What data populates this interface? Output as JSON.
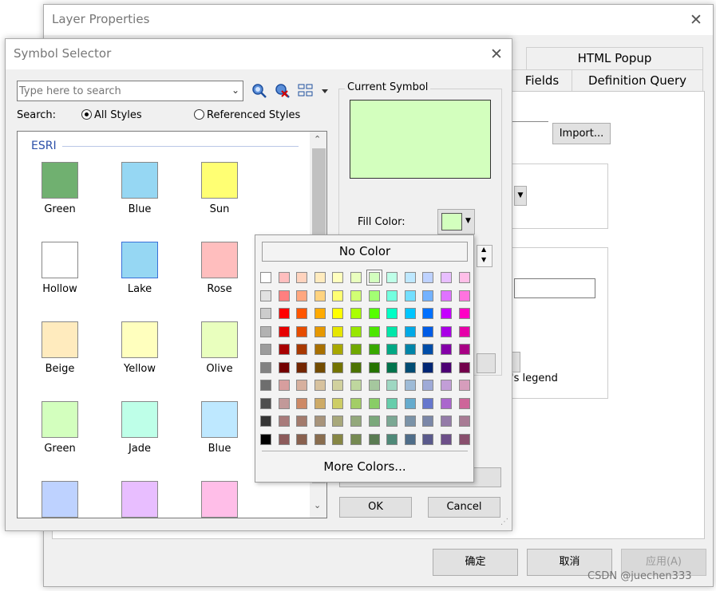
{
  "layer_properties": {
    "title": "Layer Properties",
    "tabs": [
      "HTML Popup",
      "Fields",
      "Definition Query"
    ],
    "import_label": "Import...",
    "legend_fragment": "'s legend",
    "ok_label": "确定",
    "cancel_label": "取消",
    "apply_label": "应用(A)"
  },
  "symbol_selector": {
    "title": "Symbol Selector",
    "search_placeholder": "Type here to search",
    "search_label": "Search:",
    "all_styles_label": "All Styles",
    "referenced_styles_label": "Referenced Styles",
    "search_mode": "All Styles",
    "group_label": "ESRI",
    "symbols": [
      {
        "name": "Green",
        "color": "#70b070"
      },
      {
        "name": "Blue",
        "color": "#96d7f3"
      },
      {
        "name": "Sun",
        "color": "#ffff73"
      },
      {
        "name": "Hollow",
        "color": "#ffffff"
      },
      {
        "name": "Lake",
        "color": "#96d7f3"
      },
      {
        "name": "Rose",
        "color": "#ffbebe"
      },
      {
        "name": "Beige",
        "color": "#ffebbe"
      },
      {
        "name": "Yellow",
        "color": "#ffffbe"
      },
      {
        "name": "Olive",
        "color": "#e9ffbe"
      },
      {
        "name": "Green",
        "color": "#d3ffbe"
      },
      {
        "name": "Jade",
        "color": "#beffe8"
      },
      {
        "name": "Blue",
        "color": "#bee8ff"
      },
      {
        "name": "",
        "color": "#bed2ff"
      },
      {
        "name": "",
        "color": "#e8beff"
      },
      {
        "name": "",
        "color": "#ffbee8"
      }
    ],
    "current_symbol_label": "Current Symbol",
    "current_symbol_color": "#d3ffbe",
    "fill_color_label": "Fill Color:",
    "fill_color": "#d3ffbe",
    "ok_label": "OK",
    "cancel_label": "Cancel"
  },
  "color_picker": {
    "no_color_label": "No Color",
    "more_colors_label": "More Colors...",
    "selected": [
      0,
      6
    ],
    "rows": [
      [
        "#ffffff",
        "#ffbebe",
        "#ffd3be",
        "#ffebbe",
        "#ffffbe",
        "#e9ffbe",
        "#d3ffbe",
        "#beffe8",
        "#bee8ff",
        "#bed2ff",
        "#e8beff",
        "#ffbee8"
      ],
      [
        "#e1e1e1",
        "#ff7f7f",
        "#ffa77f",
        "#ffd37f",
        "#ffff73",
        "#d1ff73",
        "#a3ff73",
        "#73ffdf",
        "#73dfff",
        "#73b2ff",
        "#df73ff",
        "#ff73df"
      ],
      [
        "#cccccc",
        "#ff0000",
        "#ff5500",
        "#ffaa00",
        "#ffff00",
        "#aaff00",
        "#55ff00",
        "#00ffc5",
        "#00c5ff",
        "#0070ff",
        "#c500ff",
        "#ff00c5"
      ],
      [
        "#b2b2b2",
        "#e60000",
        "#e64c00",
        "#e69800",
        "#e6e600",
        "#98e600",
        "#4ce600",
        "#00e6a9",
        "#00a9e6",
        "#005ce6",
        "#a900e6",
        "#e600a9"
      ],
      [
        "#9c9c9c",
        "#a80000",
        "#a83800",
        "#a87000",
        "#a8a800",
        "#70a800",
        "#38a800",
        "#00a884",
        "#0084a8",
        "#004da8",
        "#8400a8",
        "#a80084"
      ],
      [
        "#828282",
        "#730000",
        "#732600",
        "#734c00",
        "#737300",
        "#4c7300",
        "#267300",
        "#00734c",
        "#004c73",
        "#002673",
        "#4c0073",
        "#73004c"
      ],
      [
        "#6e6e6e",
        "#d79e9e",
        "#d7b09e",
        "#d7c29e",
        "#d1d19e",
        "#bfd79e",
        "#a5c79e",
        "#9ed7c2",
        "#9ebbd7",
        "#9eaad7",
        "#c29ed7",
        "#d69dbc"
      ],
      [
        "#4e4e4e",
        "#c29999",
        "#cd8966",
        "#cdaa66",
        "#cdcd66",
        "#a3cd66",
        "#89cd66",
        "#66cdab",
        "#66abcd",
        "#6677cd",
        "#aa66cd",
        "#cd6699"
      ],
      [
        "#343434",
        "#a87b7b",
        "#a37b6d",
        "#a8947b",
        "#a8a87b",
        "#93a87b",
        "#7ba87b",
        "#7ba894",
        "#7b93a8",
        "#7b87a8",
        "#947ba8",
        "#a87b94"
      ],
      [
        "#000000",
        "#8c5a5a",
        "#89614f",
        "#896d4f",
        "#868644",
        "#768a52",
        "#5a7b52",
        "#4f8978",
        "#4f6d89",
        "#5a5a8c",
        "#6d4f89",
        "#894f6d"
      ]
    ]
  },
  "watermark": "CSDN @juechen333"
}
